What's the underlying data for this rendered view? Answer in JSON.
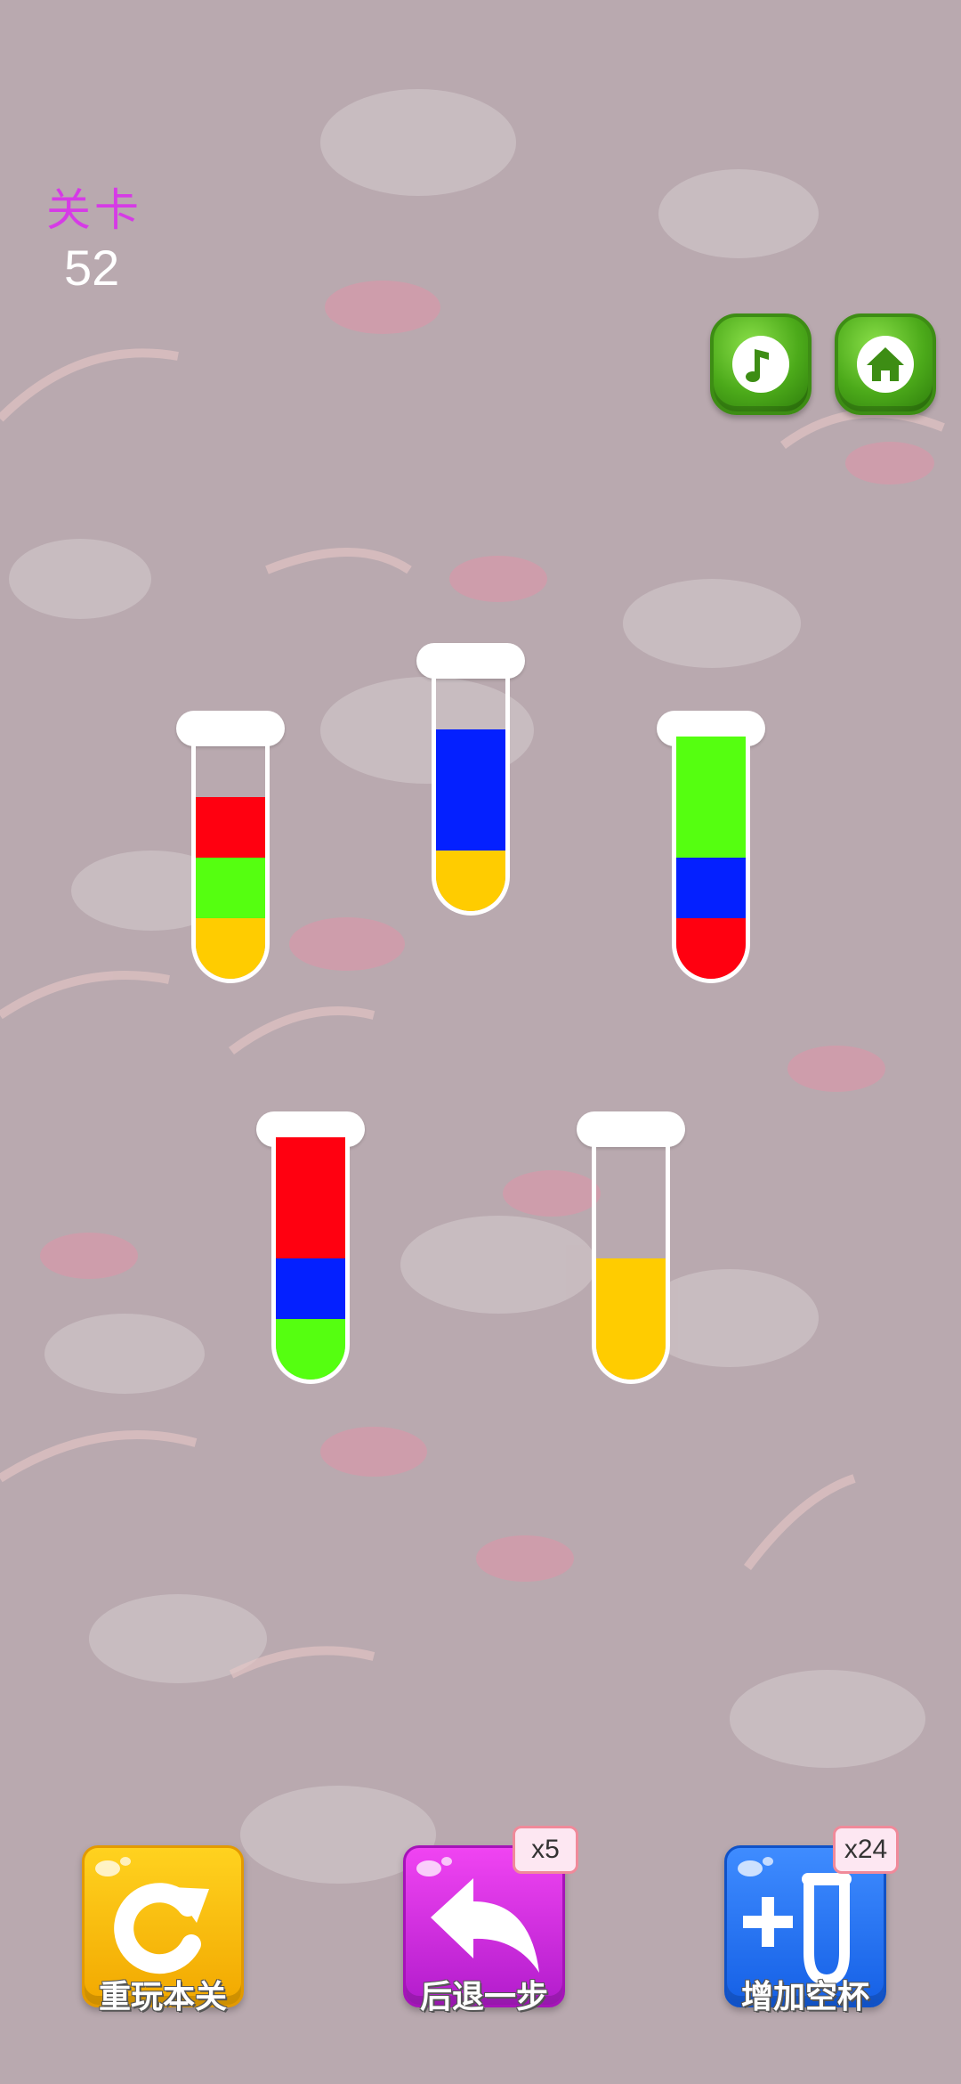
{
  "level": {
    "label": "关卡",
    "number": "52"
  },
  "top_buttons": [
    {
      "name": "music-button",
      "icon": "music-note-icon",
      "color": "#4caa1a"
    },
    {
      "name": "home-button",
      "icon": "home-icon",
      "color": "#4caa1a"
    }
  ],
  "palette": {
    "red": "#ff0010",
    "green": "#55ff10",
    "yellow": "#ffcc00",
    "blue": "#0420ff"
  },
  "tubes": [
    {
      "id": 1,
      "layers_bottom_to_top": [
        "yellow",
        "green",
        "red"
      ],
      "capacity": 4
    },
    {
      "id": 2,
      "layers_bottom_to_top": [
        "yellow",
        "blue",
        "blue"
      ],
      "capacity": 4
    },
    {
      "id": 3,
      "layers_bottom_to_top": [
        "red",
        "blue",
        "green",
        "green"
      ],
      "capacity": 4
    },
    {
      "id": 4,
      "layers_bottom_to_top": [
        "green",
        "blue",
        "red",
        "red"
      ],
      "capacity": 4
    },
    {
      "id": 5,
      "layers_bottom_to_top": [
        "yellow",
        "yellow"
      ],
      "capacity": 4
    }
  ],
  "actions": {
    "restart": {
      "label": "重玩本关",
      "icon": "restart-icon"
    },
    "undo": {
      "label": "后退一步",
      "icon": "undo-icon",
      "count": "x5"
    },
    "add_tube": {
      "label": "增加空杯",
      "icon": "add-tube-icon",
      "count": "x24"
    }
  }
}
